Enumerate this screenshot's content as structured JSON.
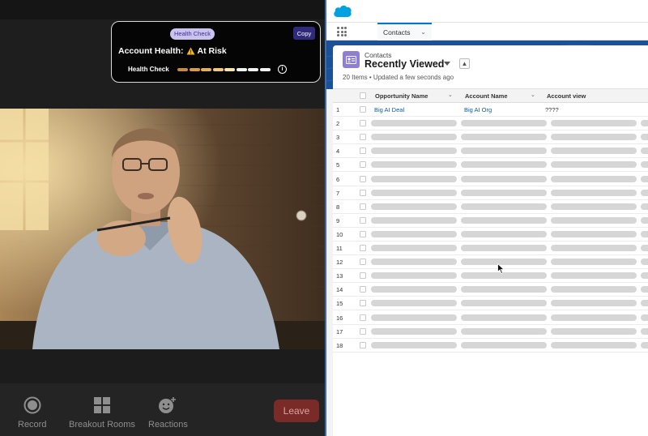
{
  "overlay": {
    "tag": "Health Check",
    "copy_label": "Copy",
    "title": "Account Health:",
    "status": "At Risk",
    "row_label": "Health Check",
    "bar_colors": [
      "#c8893f",
      "#d99a4b",
      "#e5ad5e",
      "#f1c77a",
      "#f7e3a6",
      "#f2f2f2",
      "#f2f2f2",
      "#f2f2f2"
    ]
  },
  "call_toolbar": {
    "record": "Record",
    "breakout": "Breakout Rooms",
    "reactions": "Reactions",
    "leave": "Leave"
  },
  "crm": {
    "nav_tab": "Contacts",
    "object_label": "Contacts",
    "list_title": "Recently Viewed",
    "meta": "20 Items • Updated a few seconds ago",
    "columns": [
      "Opportunity Name",
      "Account Name",
      "Account view"
    ],
    "rows": [
      {
        "num": "1",
        "opportunity": "Big AI Deal",
        "account": "Big AI Org",
        "view": "????"
      },
      {
        "num": "2"
      },
      {
        "num": "3"
      },
      {
        "num": "4"
      },
      {
        "num": "5"
      },
      {
        "num": "6"
      },
      {
        "num": "7"
      },
      {
        "num": "8"
      },
      {
        "num": "9"
      },
      {
        "num": "10"
      },
      {
        "num": "11"
      },
      {
        "num": "12"
      },
      {
        "num": "13"
      },
      {
        "num": "14"
      },
      {
        "num": "15"
      },
      {
        "num": "16"
      },
      {
        "num": "17"
      },
      {
        "num": "18"
      }
    ]
  },
  "colors": {
    "brand": "#00a1e0",
    "banner": "#1b5297",
    "link": "#0b5cab",
    "leave": "#7a2a27",
    "overlay_accent": "#2f2a7c"
  }
}
